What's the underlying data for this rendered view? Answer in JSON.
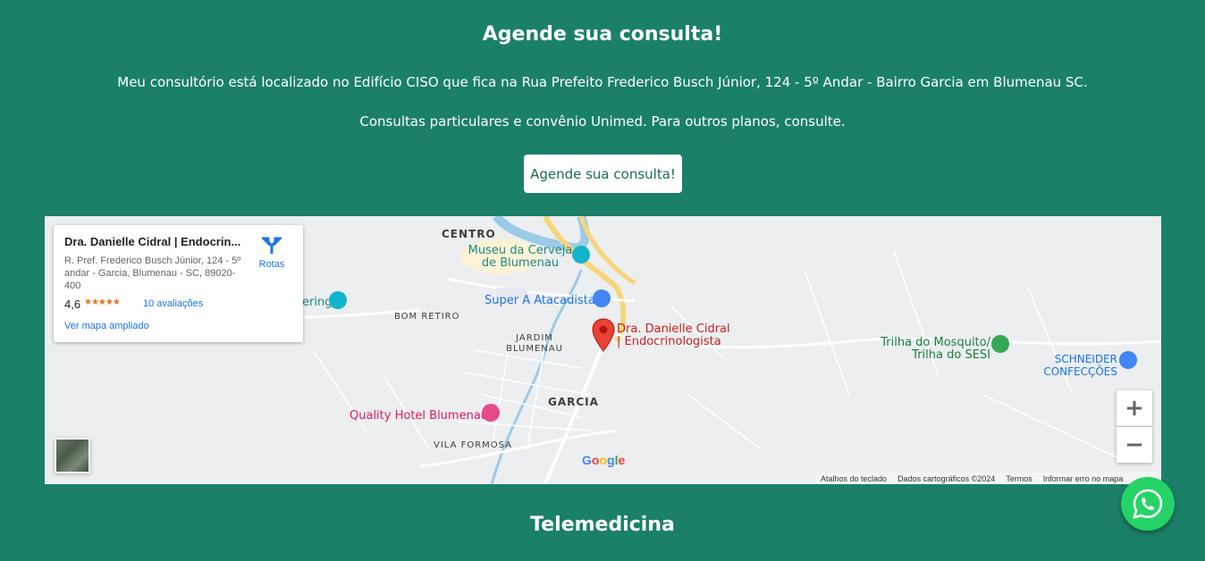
{
  "header": {
    "title": "Agende sua consulta!",
    "address_text": "Meu consultório está localizado no Edifício CISO que fica na Rua Prefeito Frederico Busch Júnior, 124 - 5º Andar - Bairro Garcia em Blumenau SC.",
    "plans_text": "Consultas particulares e convênio Unimed. Para outros planos, consulte.",
    "cta_label": "Agende sua consulta!"
  },
  "map": {
    "card": {
      "name": "Dra. Danielle Cidral | Endocrin...",
      "address": "R. Pref. Frederico Busch Júnior, 124 - 5º andar - Garcia, Blumenau - SC, 89020-400",
      "rating": "4,6",
      "stars": "★★★★★",
      "reviews": "10 avaliações",
      "larger_map": "Ver mapa ampliado",
      "routes": "Rotas"
    },
    "labels": {
      "centro": "CENTRO",
      "bom_retiro": "BOM RETIRO",
      "jardim_blumenau": "JARDIM BLUMENAU",
      "garcia": "GARCIA",
      "vila_formosa": "VILA FORMOSA",
      "museu": "Museu da Cerveja de Blumenau",
      "super": "Super A Atacadista",
      "ering": "ering",
      "marker": "Dra. Danielle Cidral | Endocrinologista",
      "hotel": "Quality Hotel Blumenau",
      "trilha": "Trilha do Mosquito/ Trilha do SESI",
      "schneider": "SCHNEIDER CONFECÇÕES"
    },
    "controls": {
      "zoom_in": "+",
      "zoom_out": "−"
    },
    "attribution": {
      "keyboard": "Atalhos do teclado",
      "map_data": "Dados cartográficos ©2024",
      "terms": "Termos",
      "report": "Informar erro no mapa"
    },
    "logo": "Google"
  },
  "footer": {
    "title": "Telemedicina"
  },
  "colors": {
    "background": "#1b8068",
    "whatsapp": "#25d366",
    "marker": "#ea4335"
  }
}
